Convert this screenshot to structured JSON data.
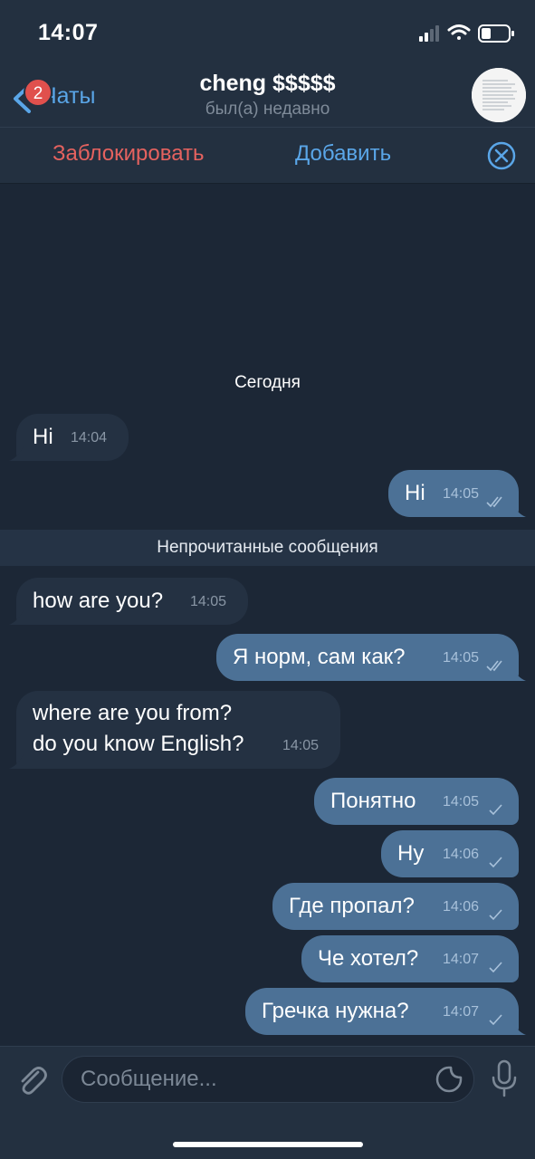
{
  "status_bar": {
    "time": "14:07"
  },
  "header": {
    "back_label": "Чаты",
    "unread_badge": "2",
    "title": "cheng $$$$$",
    "subtitle": "был(а) недавно"
  },
  "actions": {
    "block_label": "Заблокировать",
    "add_label": "Добавить"
  },
  "chat": {
    "date_separator": "Сегодня",
    "unread_separator": "Непрочитанные сообщения",
    "messages": [
      {
        "direction": "in",
        "text": "Hi",
        "time": "14:04"
      },
      {
        "direction": "out",
        "text": "Hi",
        "time": "14:05",
        "status": "read"
      },
      {
        "direction": "in",
        "text": "how are you?",
        "time": "14:05"
      },
      {
        "direction": "out",
        "text": "Я норм, сам как?",
        "time": "14:05",
        "status": "read"
      },
      {
        "direction": "in",
        "text": "where are you from?\ndo you know English?",
        "time": "14:05"
      },
      {
        "direction": "out",
        "text": "Понятно",
        "time": "14:05",
        "status": "sent"
      },
      {
        "direction": "out",
        "text": "Ну",
        "time": "14:06",
        "status": "sent"
      },
      {
        "direction": "out",
        "text": "Где пропал?",
        "time": "14:06",
        "status": "sent"
      },
      {
        "direction": "out",
        "text": "Че хотел?",
        "time": "14:07",
        "status": "sent"
      },
      {
        "direction": "out",
        "text": "Гречка нужна?",
        "time": "14:07",
        "status": "sent"
      }
    ]
  },
  "composer": {
    "placeholder": "Сообщение..."
  },
  "colors": {
    "background": "#1c2736",
    "bar": "#233040",
    "incoming_bubble": "#243142",
    "outgoing_bubble": "#4c7196",
    "accent": "#5aa6e8",
    "danger": "#e5625f"
  }
}
